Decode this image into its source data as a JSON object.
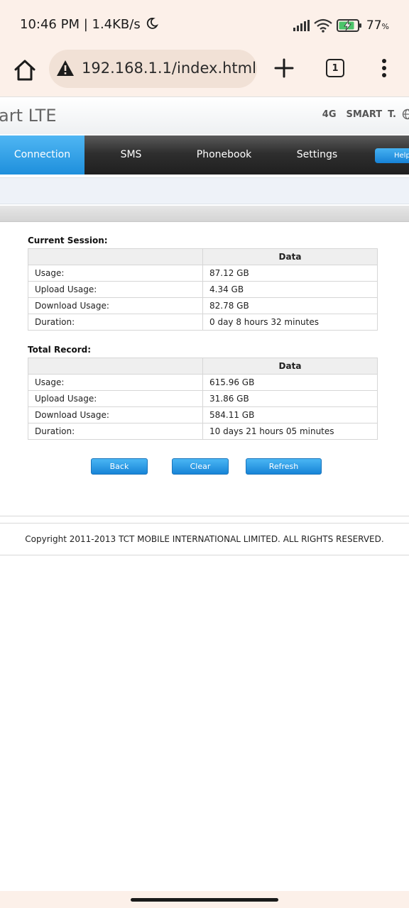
{
  "status_bar": {
    "time_speed": "10:46 PM | 1.4KB/s",
    "battery_percent": "77",
    "battery_percent_sign": "%",
    "icons": [
      "moon-icon",
      "signal-icon",
      "wifi-icon",
      "battery-charging-icon"
    ]
  },
  "browser": {
    "url": "192.168.1.1/index.html",
    "tab_count": "1",
    "icons": [
      "home-icon",
      "warning-icon",
      "plus-icon",
      "tabs-icon",
      "more-vert-icon"
    ]
  },
  "header": {
    "brand": "art LTE",
    "network_type": "4G",
    "carrier": "SMART",
    "carrier_mark": "T."
  },
  "nav": {
    "tabs": [
      {
        "label": "Connection",
        "active": true
      },
      {
        "label": "SMS",
        "active": false
      },
      {
        "label": "Phonebook",
        "active": false
      },
      {
        "label": "Settings",
        "active": false
      }
    ],
    "help_label": "Help"
  },
  "current_session": {
    "title": "Current Session",
    "title_suffix": ":",
    "column_header": "Data",
    "rows": [
      {
        "label": "Usage:",
        "value": "87.12 GB"
      },
      {
        "label": "Upload Usage:",
        "value": "4.34 GB"
      },
      {
        "label": "Download Usage:",
        "value": "82.78 GB"
      },
      {
        "label": "Duration:",
        "value": "0 day 8 hours 32 minutes"
      }
    ]
  },
  "total_record": {
    "title": "Total Record:",
    "column_header": "Data",
    "rows": [
      {
        "label": "Usage:",
        "value": "615.96 GB"
      },
      {
        "label": "Upload Usage:",
        "value": "31.86 GB"
      },
      {
        "label": "Download Usage:",
        "value": "584.11 GB"
      },
      {
        "label": "Duration:",
        "value": "10 days 21 hours 05 minutes"
      }
    ]
  },
  "buttons": {
    "back": "Back",
    "clear": "Clear",
    "refresh": "Refresh"
  },
  "footer": {
    "copyright": "Copyright 2011-2013 TCT MOBILE INTERNATIONAL LIMITED. ALL RIGHTS RESERVED."
  },
  "colors": {
    "chrome_background": "#fcf0e9",
    "url_pill": "#f1e1d6",
    "nav_active": "#2b9be5",
    "nav_dark": "#262626",
    "button_blue": "#1e8fdc"
  }
}
